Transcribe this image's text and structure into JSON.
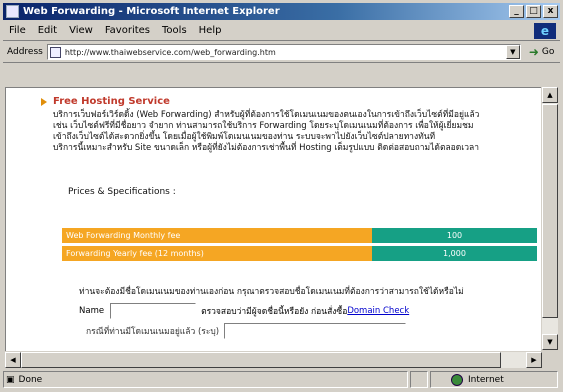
{
  "window": {
    "title": "Web Forwarding - Microsoft Internet Explorer",
    "min_label": "_",
    "max_label": "□",
    "close_label": "x"
  },
  "menu": {
    "items": [
      "File",
      "Edit",
      "View",
      "Favorites",
      "Tools",
      "Help"
    ]
  },
  "address": {
    "label": "Address",
    "url": "http://www.thaiwebservice.com/web_forwarding.htm",
    "go_label": "Go"
  },
  "content": {
    "section_title": "Free Hosting Service",
    "description": "บริการเว็บฟอร์เวิร์ดดิ้ง (Web Forwarding) สำหรับผู้ที่ต้องการใช้โดเมนเนมของตนเองในการเข้าถึงเว็บไซต์ที่มีอยู่แล้ว\nเช่น เว็บไซต์ฟรีที่มีชื่อยาว จำยาก ท่านสามารถใช้บริการ Forwarding โดยระบุโดเมนเนมที่ต้องการ เพื่อให้ผู้เยี่ยมชม\nเข้าถึงเว็บไซต์ได้สะดวกยิ่งขึ้น โดยเมื่อผู้ใช้พิมพ์โดเมนเนมของท่าน ระบบจะพาไปยังเว็บไซต์ปลายทางทันที\nบริการนี้เหมาะสำหรับ Site ขนาดเล็ก หรือผู้ที่ยังไม่ต้องการเช่าพื้นที่ Hosting เต็มรูปแบบ ติดต่อสอบถามได้ตลอดเวลา",
    "prices_heading": "Prices & Specifications :",
    "price_rows": [
      {
        "label": "Web Forwarding Monthly fee",
        "value": "100"
      },
      {
        "label": "Forwarding Yearly fee (12 months)",
        "value": "1,000"
      }
    ],
    "domain_intro": "ท่านจะต้องมีชื่อโดเมนเนมของท่านเองก่อน กรุณาตรวจสอบชื่อโดเมนเนมที่ต้องการว่าสามารถใช้ได้หรือไม่",
    "domain_label": "Name",
    "domain_input_value": "",
    "domain_after": "ตรวจสอบว่ามีผู้จดชื่อนี้หรือยัง ก่อนสั่งซื้อ",
    "domain_link": "Domain Check",
    "existing_label": "กรณีที่ท่านมีโดเมนเนมอยู่แล้ว (ระบุ)",
    "existing_input_value": ""
  },
  "status": {
    "text": "Done",
    "zone": "Internet"
  }
}
